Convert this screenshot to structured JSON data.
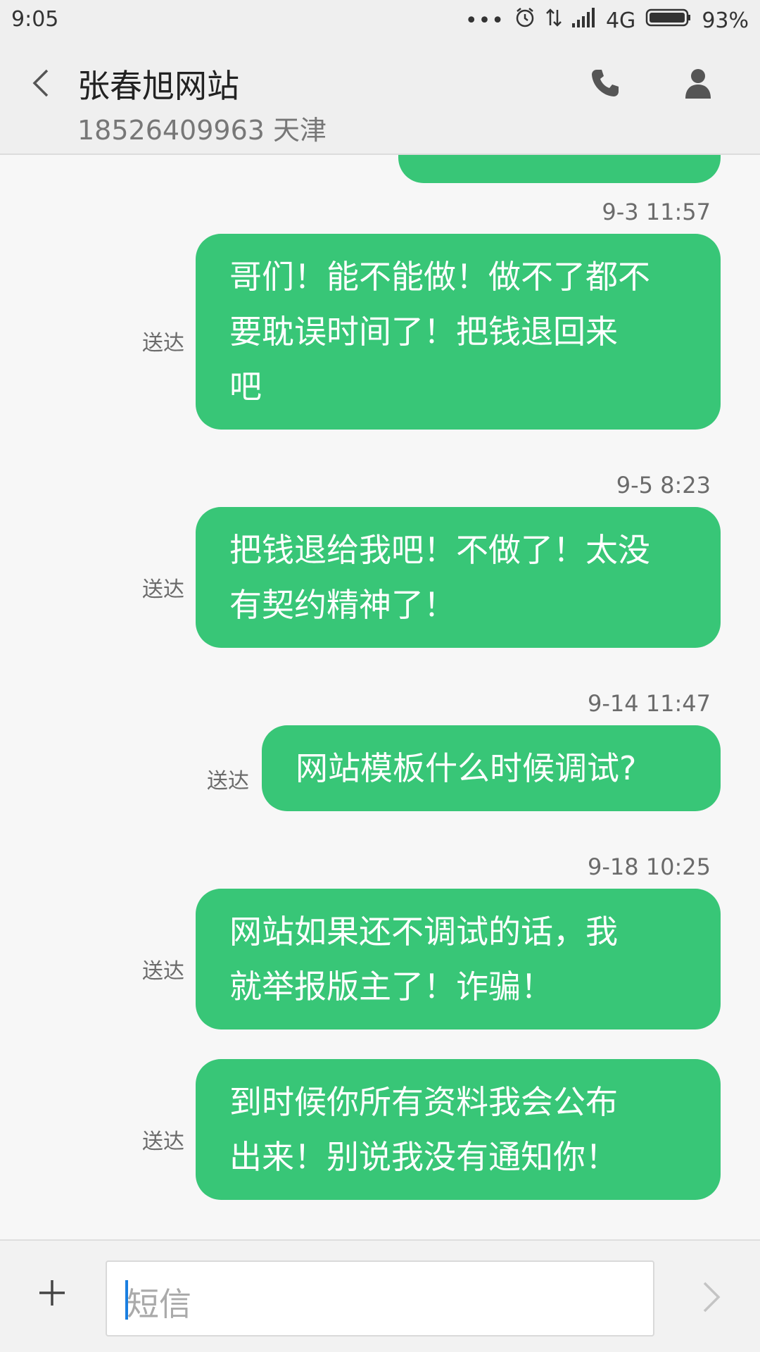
{
  "status_bar": {
    "time": "9:05",
    "network": "4G",
    "battery": "93%",
    "icons": [
      "more-dots-icon",
      "alarm-icon",
      "data-arrows-icon",
      "signal-icon",
      "battery-icon"
    ]
  },
  "header": {
    "contact_name": "张春旭网站",
    "contact_detail": "18526409963 天津",
    "icons": [
      "back-chevron-icon",
      "phone-icon",
      "person-icon"
    ]
  },
  "messages": [
    {
      "timestamp": "9-3 11:57",
      "text": "哥们！能不能做！做不了都不要耽误时间了！把钱退回来吧",
      "lines": [
        "哥们！能不能做！做不了都不",
        "要耽误时间了！把钱退回来",
        "吧"
      ],
      "status": "送达"
    },
    {
      "timestamp": "9-5 8:23",
      "text": "把钱退给我吧！不做了！太没有契约精神了！",
      "lines": [
        "把钱退给我吧！不做了！太没",
        "有契约精神了！"
      ],
      "status": "送达"
    },
    {
      "timestamp": "9-14 11:47",
      "text": "网站模板什么时候调试?",
      "lines": [
        "网站模板什么时候调试?"
      ],
      "status": "送达"
    },
    {
      "timestamp": "9-18 10:25",
      "text": "网站如果还不调试的话，我就举报版主了！诈骗！",
      "lines": [
        "网站如果还不调试的话，我",
        "就举报版主了！诈骗！"
      ],
      "status": "送达"
    },
    {
      "timestamp": "",
      "text": "到时候你所有资料我会公布出来！别说我没有通知你！",
      "lines": [
        "到时候你所有资料我会公布",
        "出来！别说我没有通知你！"
      ],
      "status": "送达"
    }
  ],
  "composer": {
    "placeholder": "短信",
    "icons": [
      "plus-icon",
      "send-chevron-icon"
    ]
  },
  "colors": {
    "bubble": "#38c677",
    "background": "#f7f7f7",
    "header": "#efefef",
    "caret": "#1a7fe0"
  }
}
